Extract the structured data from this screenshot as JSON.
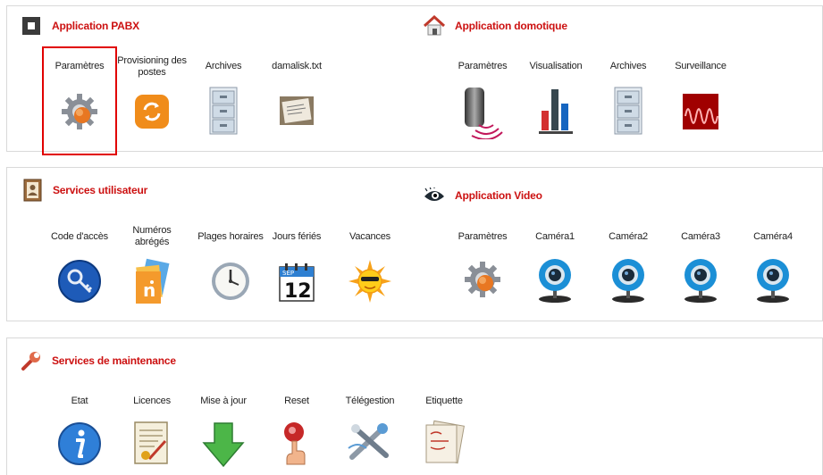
{
  "sections": {
    "pabx": {
      "title": "Application PABX",
      "icon": "square-app-icon",
      "items": [
        {
          "label": "Paramètres",
          "icon": "gear-icon"
        },
        {
          "label": "Provisioning des postes",
          "icon": "provisioning-icon"
        },
        {
          "label": "Archives",
          "icon": "cabinet-icon"
        },
        {
          "label": "damalisk.txt",
          "icon": "document-icon"
        }
      ]
    },
    "domotique": {
      "title": "Application domotique",
      "icon": "house-icon",
      "items": [
        {
          "label": "Paramètres",
          "icon": "sensor-icon"
        },
        {
          "label": "Visualisation",
          "icon": "bar-chart-icon"
        },
        {
          "label": "Archives",
          "icon": "cabinet-icon"
        },
        {
          "label": "Surveillance",
          "icon": "waveform-icon"
        }
      ]
    },
    "utilisateur": {
      "title": "Services utilisateur",
      "icon": "address-book-icon",
      "items": [
        {
          "label": "Code d'accès",
          "icon": "key-icon"
        },
        {
          "label": "Numéros abrégés",
          "icon": "contact-cards-icon"
        },
        {
          "label": "Plages horaires",
          "icon": "clock-icon"
        },
        {
          "label": "Jours fériés",
          "icon": "calendar-icon",
          "calendar_month": "SEP",
          "calendar_day": "12"
        },
        {
          "label": "Vacances",
          "icon": "sun-icon"
        }
      ]
    },
    "video": {
      "title": "Application Video",
      "icon": "eye-icon",
      "items": [
        {
          "label": "Paramètres",
          "icon": "gear-icon"
        },
        {
          "label": "Caméra1",
          "icon": "webcam-icon"
        },
        {
          "label": "Caméra2",
          "icon": "webcam-icon"
        },
        {
          "label": "Caméra3",
          "icon": "webcam-icon"
        },
        {
          "label": "Caméra4",
          "icon": "webcam-icon"
        }
      ]
    },
    "maintenance": {
      "title": "Services de maintenance",
      "icon": "wrench-icon",
      "items": [
        {
          "label": "Etat",
          "icon": "info-icon"
        },
        {
          "label": "Licences",
          "icon": "license-icon"
        },
        {
          "label": "Mise à jour",
          "icon": "down-arrow-icon"
        },
        {
          "label": "Reset",
          "icon": "reset-button-icon"
        },
        {
          "label": "Télégestion",
          "icon": "remote-tools-icon"
        },
        {
          "label": "Etiquette",
          "icon": "label-icon"
        }
      ]
    }
  },
  "colors": {
    "section_title": "#cc1111",
    "highlight": "#e10000",
    "panel_border": "#d9d9d9"
  }
}
